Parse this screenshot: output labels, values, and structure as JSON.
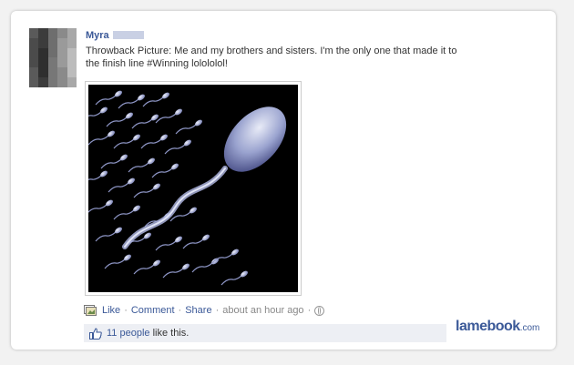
{
  "post": {
    "author": "Myra",
    "text": "Throwback Picture: Me and my brothers and sisters. I'm the only one that made it to the finish line #Winning lolololol!"
  },
  "actions": {
    "like": "Like",
    "sep1": "·",
    "comment": "Comment",
    "sep2": "·",
    "share": "Share",
    "sep3": "·",
    "time": "about an hour ago",
    "sep4": "·"
  },
  "likes": {
    "count": "11 people",
    "suffix": " like this."
  },
  "watermark": {
    "brand": "lamebook",
    "tld": ".com"
  },
  "icons": {
    "avatar": "avatar-pixelated",
    "story": "story-photo-icon",
    "globe": "globe-icon",
    "like": "thumbs-up-icon"
  },
  "colors": {
    "link": "#3b5998",
    "likes_bg": "#edeff4"
  }
}
